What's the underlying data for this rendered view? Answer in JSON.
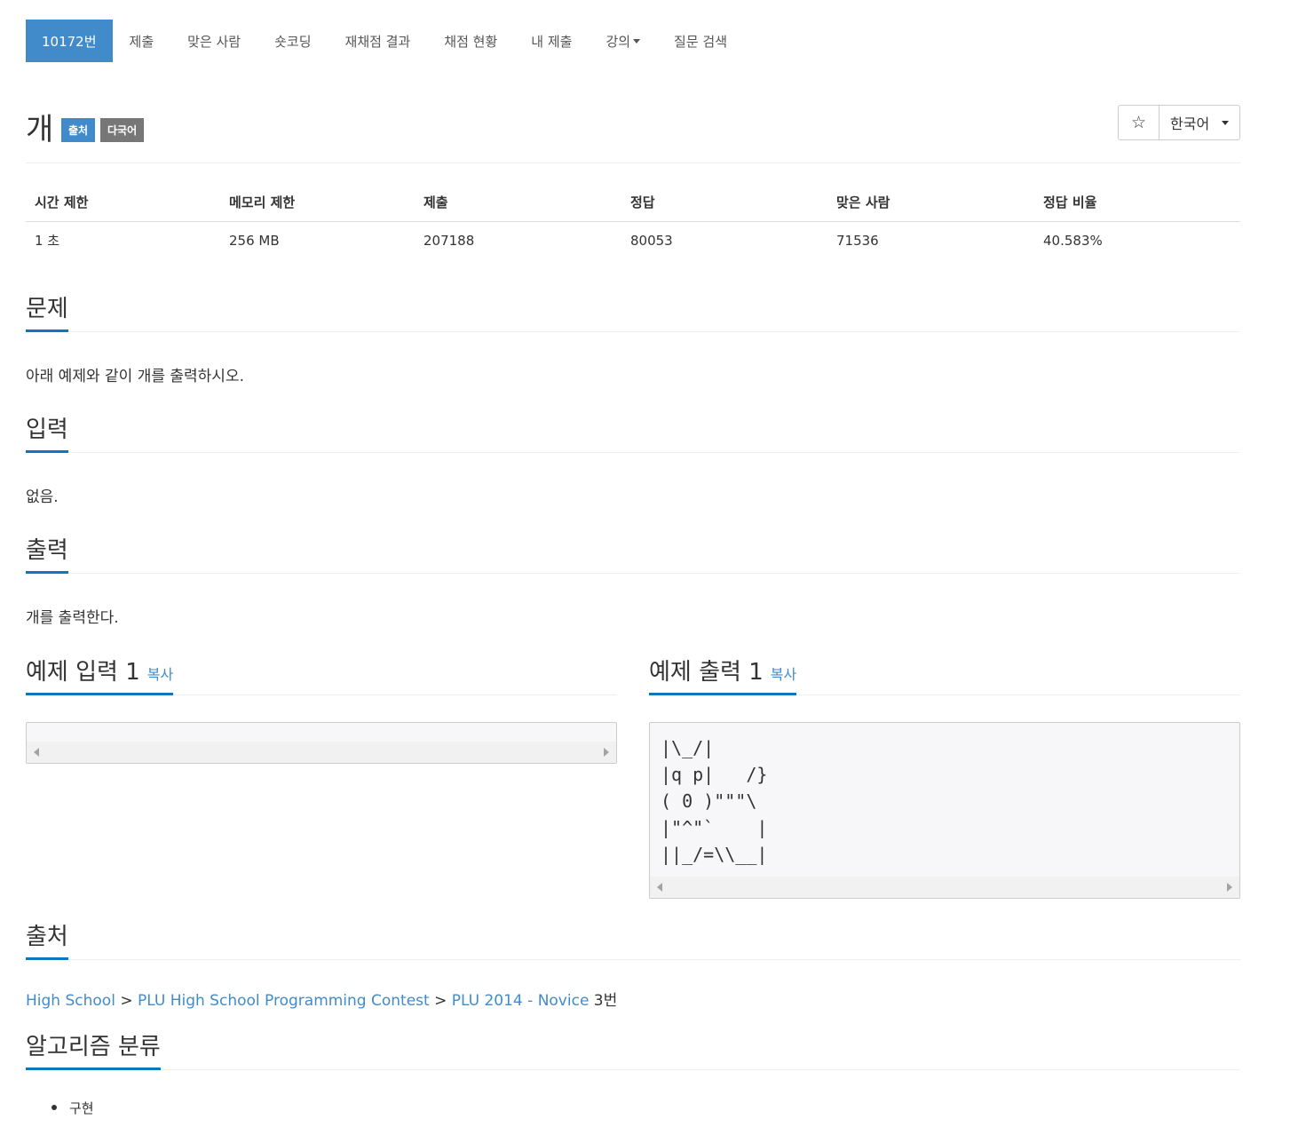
{
  "nav": {
    "items": [
      {
        "label": "10172번"
      },
      {
        "label": "제출"
      },
      {
        "label": "맞은 사람"
      },
      {
        "label": "숏코딩"
      },
      {
        "label": "재채점 결과"
      },
      {
        "label": "채점 현황"
      },
      {
        "label": "내 제출"
      },
      {
        "label": "강의"
      },
      {
        "label": "질문 검색"
      }
    ]
  },
  "problem": {
    "title": "개",
    "badges": {
      "source": "출처",
      "multilang": "다국어"
    },
    "star_icon": "☆",
    "language": "한국어"
  },
  "stats": {
    "headers": [
      "시간 제한",
      "메모리 제한",
      "제출",
      "정답",
      "맞은 사람",
      "정답 비율"
    ],
    "values": [
      "1 초",
      "256 MB",
      "207188",
      "80053",
      "71536",
      "40.583%"
    ]
  },
  "sections": {
    "problem": {
      "title": "문제",
      "text": "아래 예제와 같이 개를 출력하시오."
    },
    "input": {
      "title": "입력",
      "text": "없음."
    },
    "output": {
      "title": "출력",
      "text": "개를 출력한다."
    },
    "sample_input": {
      "title": "예제 입력 1",
      "copy": "복사",
      "content": ""
    },
    "sample_output": {
      "title": "예제 출력 1",
      "copy": "복사",
      "content": "|\\_/|\n|q p|   /}\n( 0 )\"\"\"\\\n|\"^\"`    |\n||_/=\\\\__|"
    },
    "source": {
      "title": "출처",
      "links": [
        "High School",
        "PLU High School Programming Contest",
        "PLU 2014 - Novice"
      ],
      "separator": " > ",
      "suffix": " 3번"
    },
    "tags": {
      "title": "알고리즘 분류",
      "items": [
        "구현"
      ]
    }
  }
}
